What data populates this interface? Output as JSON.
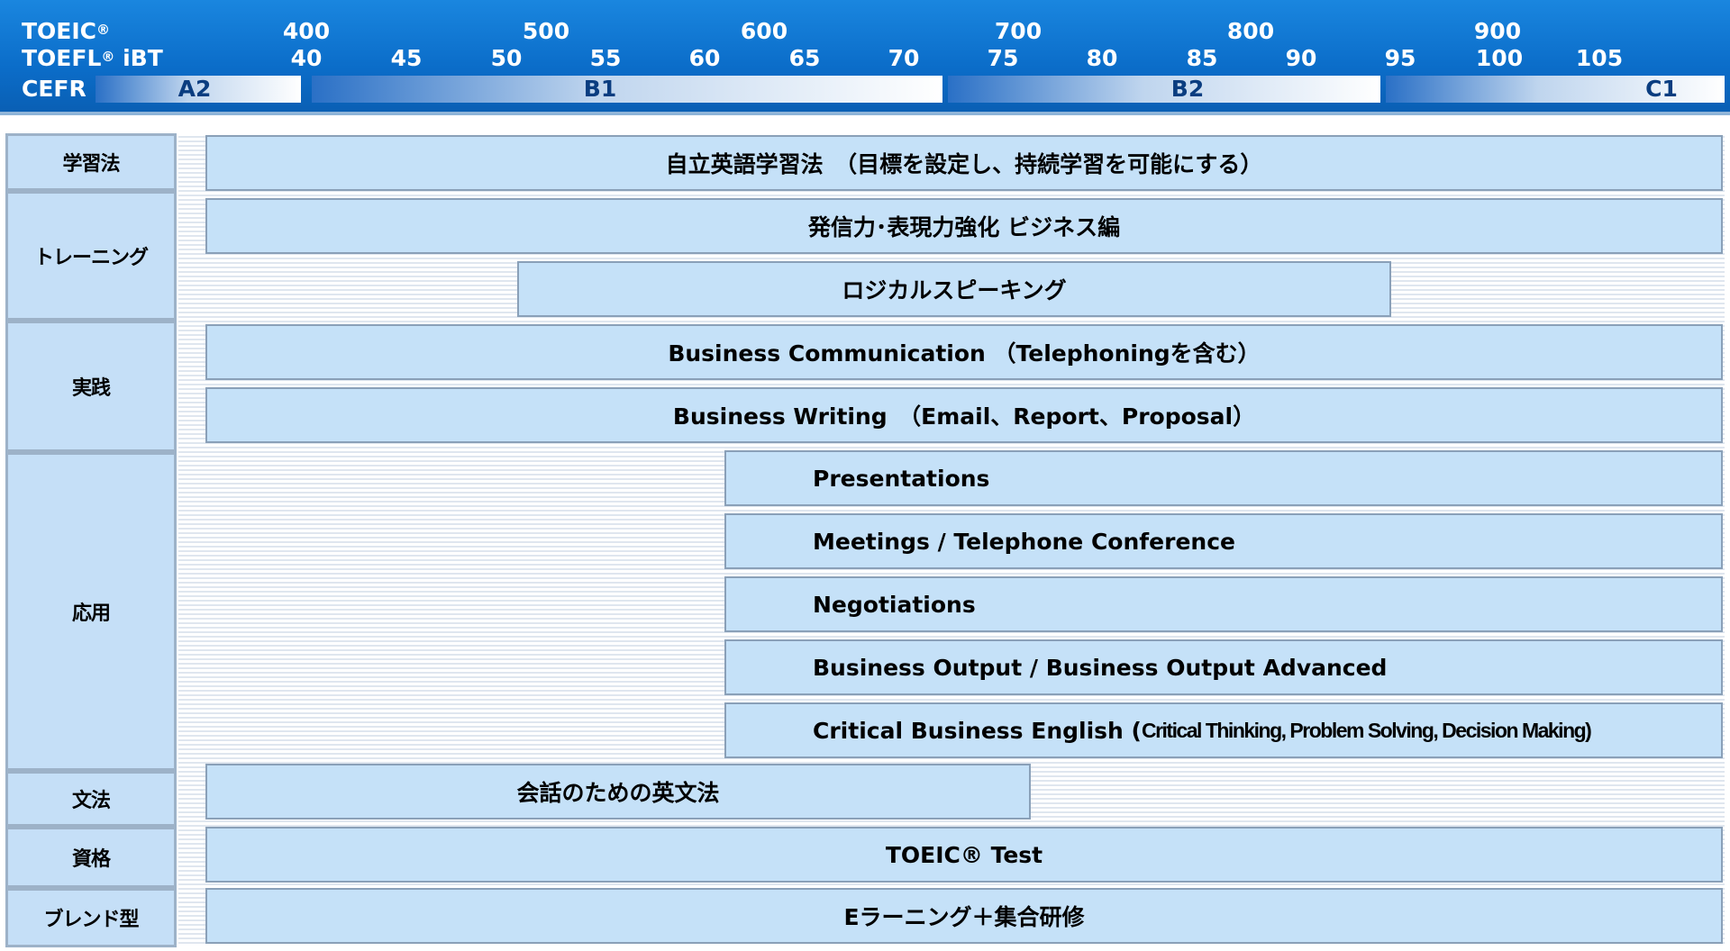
{
  "scales": {
    "toeic_label": "TOEIC",
    "toeic_mark": "®",
    "toefl_label": "TOEFL",
    "toefl_mark": "®",
    "toefl_suffix": " iBT",
    "cefr_label": "CEFR",
    "toeic_ticks": [
      "400",
      "500",
      "600",
      "700",
      "800",
      "900"
    ],
    "toefl_ticks": [
      "40",
      "45",
      "50",
      "55",
      "60",
      "65",
      "70",
      "75",
      "80",
      "85",
      "90",
      "95",
      "100",
      "105"
    ],
    "cefr_levels": [
      "A2",
      "B1",
      "B2",
      "C1"
    ]
  },
  "categories": [
    "学習法",
    "トレーニング",
    "実践",
    "応用",
    "文法",
    "資格",
    "ブレンド型"
  ],
  "courses": {
    "self_study": "自立英語学習法　（目標を設定し、持続学習を可能にする）",
    "output_business": "発信力･表現力強化 ビジネス編",
    "logical_speaking": "ロジカルスピーキング",
    "business_communication": "Business Communication （Telephoningを含む）",
    "business_writing": "Business Writing　（Email、Report、Proposal）",
    "presentations": "Presentations",
    "meetings": "Meetings /  Telephone Conference",
    "negotiations": "Negotiations",
    "business_output": "Business Output / Business Output Advanced",
    "critical_main": "Critical Business English (",
    "critical_detail": "Critical Thinking, Problem Solving, Decision Making)",
    "grammar": "会話のための英文法",
    "toeic_test": "TOEIC® Test",
    "blended": "Eラーニング＋集合研修"
  }
}
